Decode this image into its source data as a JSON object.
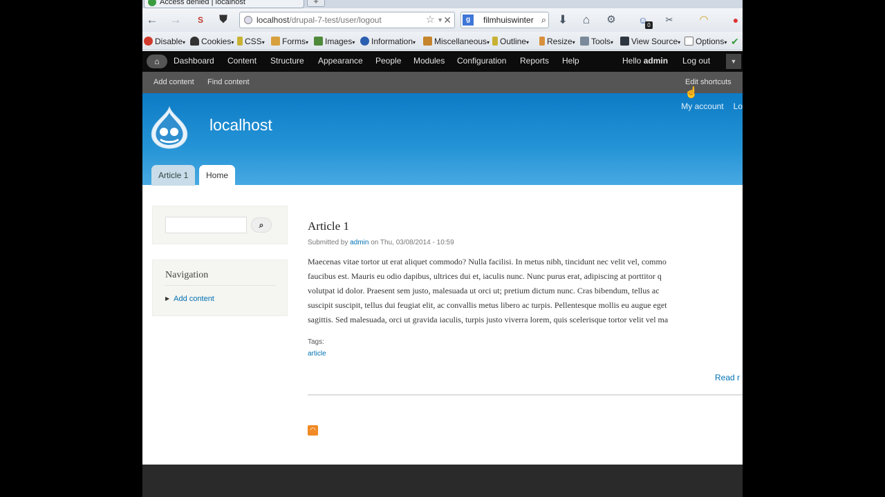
{
  "browser": {
    "tab_title": "Access denied | localhost",
    "new_tab": "+",
    "url_host": "localhost",
    "url_path": "/drupal-7-test/user/logout",
    "search_value": "filmhuiswinter",
    "search_engine_label": "g",
    "badge_count": "0"
  },
  "devbar": {
    "items": [
      "Disable",
      "Cookies",
      "CSS",
      "Forms",
      "Images",
      "Information",
      "Miscellaneous",
      "Outline",
      "Resize",
      "Tools",
      "View Source",
      "Options"
    ]
  },
  "admin_menu": {
    "items": [
      "Dashboard",
      "Content",
      "Structure",
      "Appearance",
      "People",
      "Modules",
      "Configuration",
      "Reports",
      "Help"
    ],
    "hello": "Hello",
    "user": "admin",
    "logout": "Log out"
  },
  "shortcuts": {
    "add_content": "Add content",
    "find_content": "Find content",
    "edit_shortcuts": "Edit shortcuts"
  },
  "header": {
    "site_name": "localhost",
    "my_account": "My account",
    "logout_short": "Lo",
    "tabs": [
      "Article 1",
      "Home"
    ]
  },
  "sidebar": {
    "search_placeholder": "",
    "nav_title": "Navigation",
    "nav_items": [
      "Add content"
    ]
  },
  "node": {
    "title": "Article 1",
    "submitted_prefix": "Submitted by",
    "author": "admin",
    "submitted_date": "on Thu, 03/08/2014 - 10:59",
    "body_lines": [
      "Maecenas vitae tortor ut erat aliquet commodo? Nulla facilisi. In metus nibh, tincidunt nec velit vel, commo",
      "faucibus est. Mauris eu odio dapibus, ultrices dui et, iaculis nunc. Nunc purus erat, adipiscing at porttitor q",
      "volutpat id dolor. Praesent sem justo, malesuada ut orci ut; pretium dictum nunc. Cras bibendum, tellus ac",
      "suscipit suscipit, tellus dui feugiat elit, ac convallis metus libero ac turpis. Pellentesque mollis eu augue eget",
      "sagittis. Sed malesuada, orci ut gravida iaculis, turpis justo viverra lorem, quis scelerisque tortor velit vel ma"
    ],
    "tags_label": "Tags:",
    "tag": "article",
    "read_more": "Read r"
  },
  "colors": {
    "header_top": "#0d7bc5",
    "header_bottom": "#48a9e2",
    "link": "#0071b3",
    "admin_bar": "#0c0c0c",
    "shortcut_bar": "#555555"
  }
}
